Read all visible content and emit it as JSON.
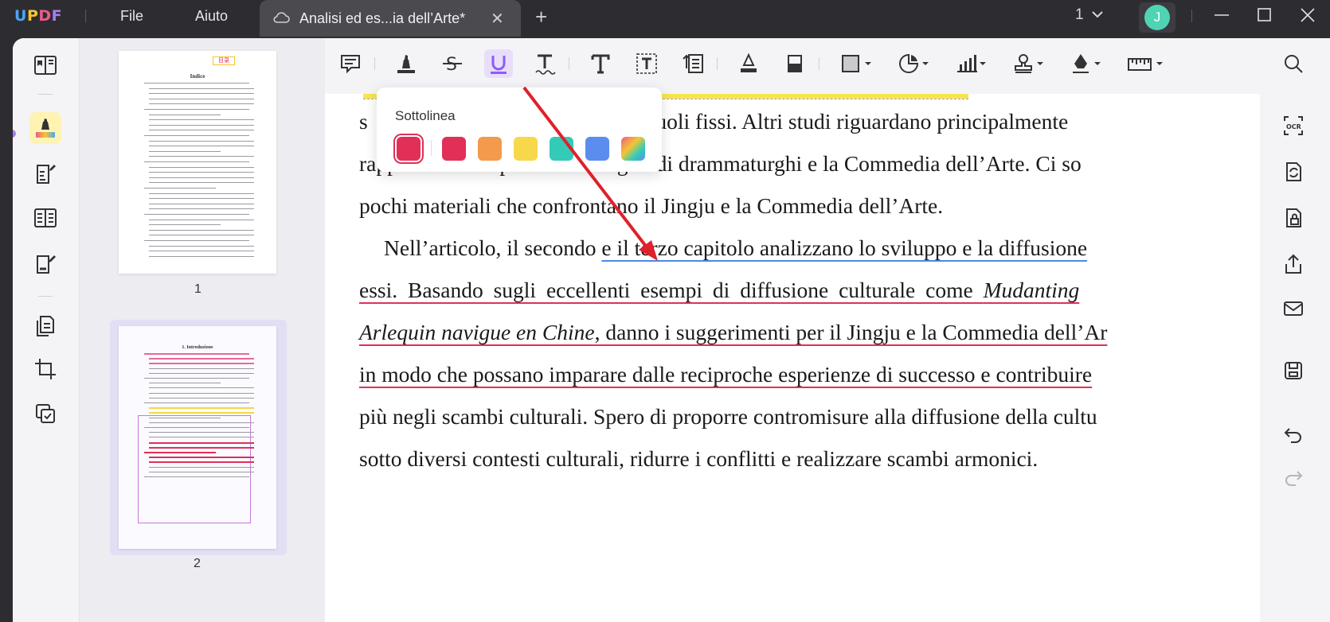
{
  "app": {
    "logo": {
      "l1": "U",
      "l2": "P",
      "l3": "D",
      "l4": "F"
    }
  },
  "menu": {
    "file": "File",
    "help": "Aiuto"
  },
  "tab": {
    "title": "Analisi ed es...ia dell’Arte*",
    "close": "✕"
  },
  "new_tab": "+",
  "page_indicator": "1",
  "user": {
    "initial": "J"
  },
  "thumbnails": [
    {
      "number": "1",
      "tag": "目录",
      "heading": "Indice"
    },
    {
      "number": "2",
      "heading": "1. Introduzione"
    }
  ],
  "popup": {
    "title": "Sottolinea",
    "swatches": [
      "#e03058",
      "#e03058",
      "#f39a4c",
      "#f6d84a",
      "#33cbb8",
      "#5b8def",
      "gradient"
    ]
  },
  "document": {
    "lines": [
      {
        "text": "s",
        "text2": "dei ruoli fissi. Altri studi riguardano principalmente"
      },
      {
        "text": "rapporto tra le opere e alcuni grandi drammaturghi e la Commedia dell’Arte. Ci so"
      },
      {
        "text": "pochi materiali che confrontano il Jingju e la Commedia dell’Arte."
      },
      {
        "indent": "Nell’articolo, il secondo",
        "blue": "e il terzo capitolo analizzano lo sviluppo e la diffusione"
      },
      {
        "red": "essi. Basando sugli eccellenti esempi di diffusione culturale come ",
        "red_italic": "Mudanting"
      },
      {
        "red_italic": "Arlequin navigue en Chine",
        "red": ", danno i suggerimenti per il Jingju e la Commedia dell’Ar"
      },
      {
        "red": "in modo che possano imparare dalle reciproche esperienze di successo e contribuire"
      },
      {
        "text": "più negli scambi culturali. Spero di proporre contromisure alla diffusione della cultu"
      },
      {
        "text": "sotto diversi contesti culturali, ridurre i conflitti e realizzare scambi armonici."
      }
    ]
  },
  "colors": {
    "accent": "#a87cf1",
    "underline_red": "#e03058",
    "underline_blue": "#4f86e8",
    "arrow": "#e0202a"
  },
  "icons": {
    "toolbar": [
      "comment-icon",
      "highlight-icon",
      "strikethrough-icon",
      "underline-icon",
      "squiggly-icon",
      "text-icon",
      "textbox-icon",
      "text-callout-icon",
      "pencil-icon",
      "eraser-icon",
      "shape-icon",
      "sticker-icon",
      "chart-icon",
      "stamp-icon",
      "signature-icon",
      "measure-icon"
    ],
    "right": [
      "search-icon",
      "ocr-icon",
      "convert-icon",
      "protect-icon",
      "share-icon",
      "mail-icon",
      "save-icon",
      "undo-icon",
      "redo-icon"
    ]
  }
}
